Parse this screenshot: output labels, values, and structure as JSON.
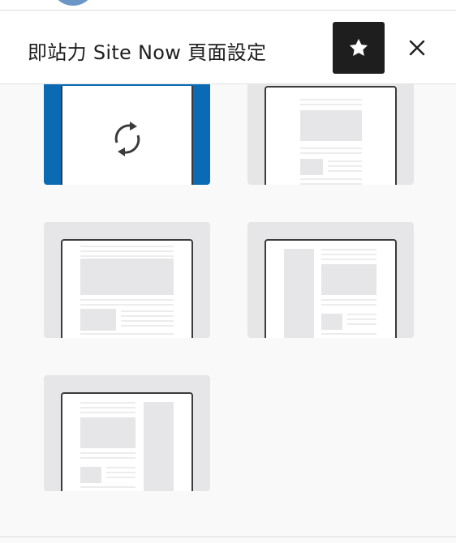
{
  "panel": {
    "title": "即站力 Site Now 頁面設定"
  },
  "toolbar": {
    "star_icon": "star-icon",
    "close_icon": "close-icon"
  },
  "templates": {
    "items": [
      {
        "name": "default",
        "selected": true,
        "icon": "sync-icon"
      },
      {
        "name": "top-image"
      },
      {
        "name": "full-width"
      },
      {
        "name": "left-sidebar"
      },
      {
        "name": "right-sidebar"
      }
    ]
  },
  "colors": {
    "selected": "#0a6ab4",
    "header_button": "#1e1e1e",
    "tile": "#e6e6e8"
  }
}
